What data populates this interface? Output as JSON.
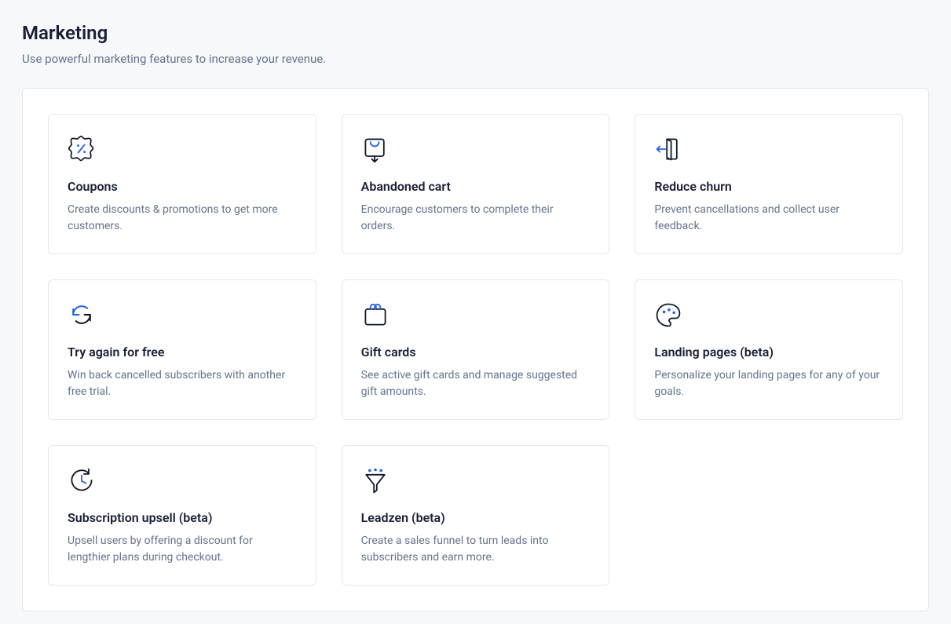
{
  "header": {
    "title": "Marketing",
    "subtitle": "Use powerful marketing features to increase your revenue."
  },
  "cards": [
    {
      "title": "Coupons",
      "desc": "Create discounts & promotions to get more customers."
    },
    {
      "title": "Abandoned cart",
      "desc": "Encourage customers to complete their orders."
    },
    {
      "title": "Reduce churn",
      "desc": "Prevent cancellations and collect user feedback."
    },
    {
      "title": "Try again for free",
      "desc": "Win back cancelled subscribers with another free trial."
    },
    {
      "title": "Gift cards",
      "desc": "See active gift cards and manage suggested gift amounts."
    },
    {
      "title": "Landing pages (beta)",
      "desc": "Personalize your landing pages for any of your goals."
    },
    {
      "title": "Subscription upsell (beta)",
      "desc": "Upsell users by offering a discount for lengthier plans during checkout."
    },
    {
      "title": "Leadzen (beta)",
      "desc": "Create a sales funnel to turn leads into subscribers and earn more."
    }
  ]
}
